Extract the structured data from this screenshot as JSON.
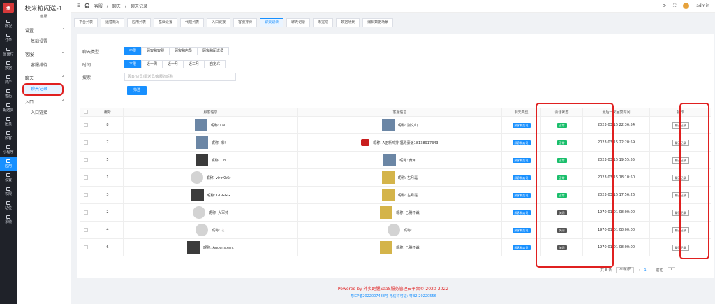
{
  "sidebar_icons": [
    {
      "label": "概况",
      "icon": "overview-icon"
    },
    {
      "label": "订单",
      "icon": "order-icon"
    },
    {
      "label": "当面付",
      "icon": "pay-icon"
    },
    {
      "label": "数据",
      "icon": "data-icon"
    },
    {
      "label": "商户",
      "icon": "merchant-icon"
    },
    {
      "label": "售后",
      "icon": "aftersale-icon"
    },
    {
      "label": "配送员",
      "icon": "courier-icon"
    },
    {
      "label": "团员",
      "icon": "member-icon"
    },
    {
      "label": "顾客",
      "icon": "customer-icon"
    },
    {
      "label": "小程序",
      "icon": "miniapp-icon"
    },
    {
      "label": "应用",
      "icon": "app-icon"
    },
    {
      "label": "设置",
      "icon": "settings-icon"
    },
    {
      "label": "权限",
      "icon": "permission-icon"
    },
    {
      "label": "站位",
      "icon": "station-icon"
    },
    {
      "label": "系统",
      "icon": "system-icon"
    }
  ],
  "subnav": {
    "title": "校米粒闪送-1",
    "subtitle": "客服",
    "groups": [
      {
        "label": "设置",
        "items": [
          "基础设置"
        ]
      },
      {
        "label": "客服",
        "items": [
          "客服排待"
        ]
      },
      {
        "label": "聊天",
        "items": [
          "聊天记录"
        ]
      },
      {
        "label": "入口",
        "items": [
          "入口链接"
        ]
      }
    ]
  },
  "topbar": {
    "crumbs": [
      "客服",
      "聊天",
      "聊天记录"
    ],
    "user": "admin"
  },
  "tabs": [
    "平台列表",
    "运营概况",
    "应用列表",
    "基础设置",
    "代理列表",
    "入口链接",
    "客服排待",
    "聊天记录",
    "聊天记录",
    "未完成",
    "数据场景",
    "编辑数据场景"
  ],
  "filters": {
    "type_label": "聊天类型",
    "type_options": [
      "不限",
      "顾客和客服",
      "顾客和店员",
      "顾客和配送员"
    ],
    "time_label": "时间",
    "time_options": [
      "不限",
      "近一周",
      "近一月",
      "近三月",
      "自定义"
    ],
    "search_label": "搜索",
    "search_placeholder": "顾客/店员/配送员/客服的昵称",
    "submit": "筛选"
  },
  "table": {
    "headers": [
      "编号",
      "顾客信息",
      "客服信息",
      "聊天类型",
      "会话状态",
      "最后一次回复时间",
      "操作"
    ],
    "rows": [
      {
        "no": "8",
        "customer": "昵称: Lau",
        "service": "昵称: 别文山",
        "type": "顾客和店员",
        "status": "正常",
        "time": "2023-03-15 22:36:54",
        "op": "聊天记录"
      },
      {
        "no": "7",
        "customer": "昵称: 嗯!",
        "service": "昵称: A正新鸡排 福殿豪饭18138917343",
        "type": "顾客和店员",
        "status": "正常",
        "time": "2023-03-15 22:20:59",
        "op": "聊天记录"
      },
      {
        "no": "5",
        "customer": "昵称: Lin",
        "service": "昵称: 黄河",
        "type": "顾客和店员",
        "status": "正常",
        "time": "2023-03-15 19:55:55",
        "op": "聊天记录"
      },
      {
        "no": "1",
        "customer": "昵称: vir-rKk6r",
        "service": "昵称: 古月磊",
        "type": "顾客和店员",
        "status": "正常",
        "time": "2023-03-15 18:10:50",
        "op": "聊天记录"
      },
      {
        "no": "3",
        "customer": "昵称: GGGGG",
        "service": "昵称: 古月磊",
        "type": "顾客和店员",
        "status": "正常",
        "time": "2023-03-15 17:56:26",
        "op": "聊天记录"
      },
      {
        "no": "2",
        "customer": "昵称: 大军帅",
        "service": "昵称: 已腾不战",
        "type": "顾客和店员",
        "status": "关闭",
        "time": "1970-01-01 08:00:00",
        "op": "聊天记录"
      },
      {
        "no": "4",
        "customer": "昵称: 🐇",
        "service": "昵称:",
        "type": "顾客和店员",
        "status": "关闭",
        "time": "1970-01-01 08:00:00",
        "op": "聊天记录"
      },
      {
        "no": "6",
        "customer": "昵称: Augenstern.",
        "service": "昵称: 已腾不战",
        "type": "顾客和店员",
        "status": "关闭",
        "time": "1970-01-01 08:00:00",
        "op": "聊天记录"
      }
    ]
  },
  "pager": {
    "total": "共 8 条",
    "size": "20条/页",
    "page": "1",
    "goto": "前往"
  },
  "footer": {
    "line1": "Powered by 外卖跑腿SaaS服务管理云平台© 2020-2022",
    "line2": "粤ICP备2022007488号   电信许可证: 粤B2-20220556"
  },
  "colors": {
    "primary": "#1890ff",
    "highlight": "#e02020",
    "ok": "#19be6b"
  }
}
